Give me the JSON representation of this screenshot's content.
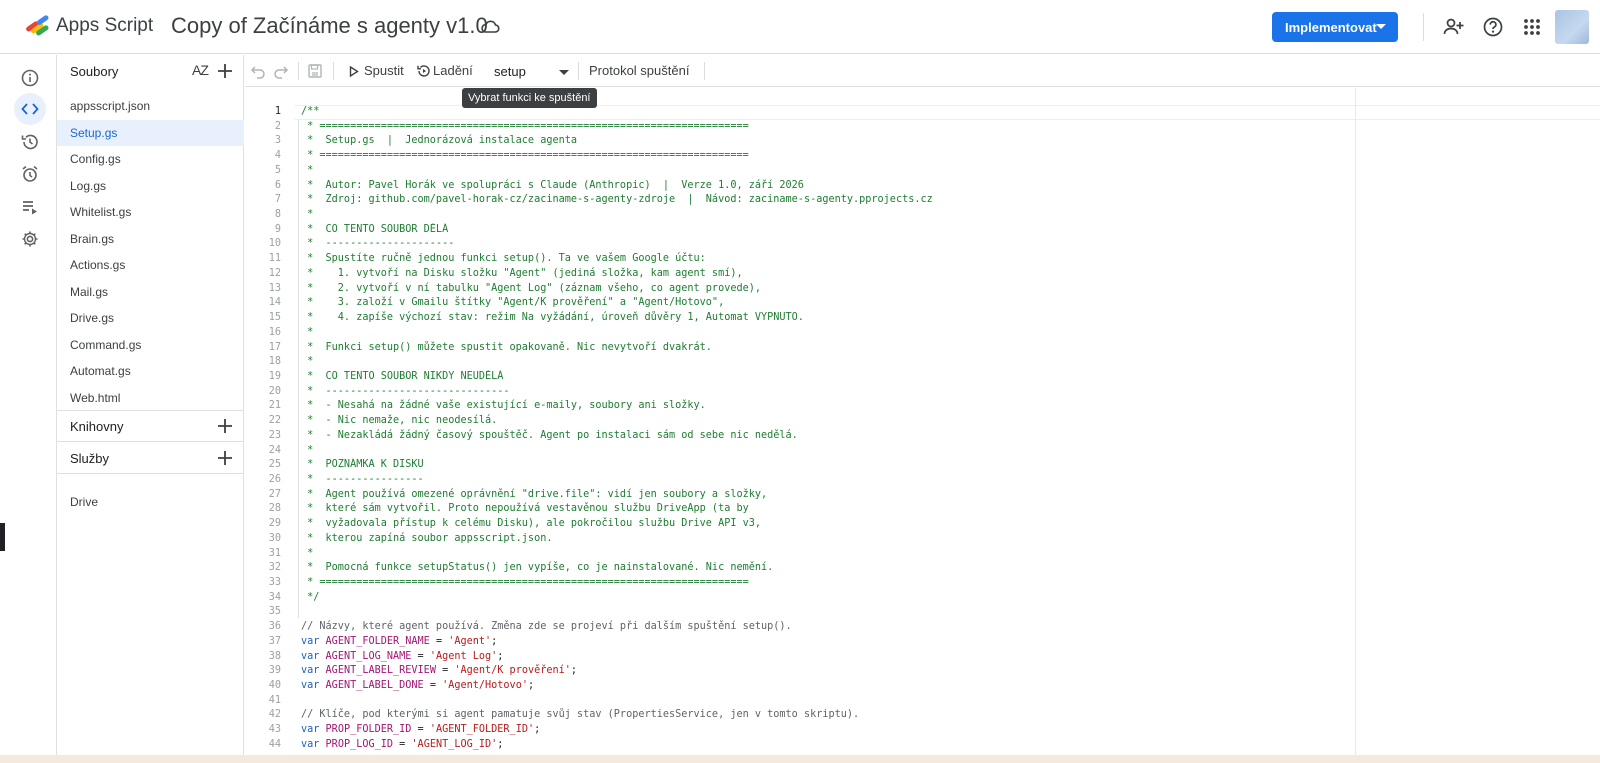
{
  "header": {
    "app_name": "Apps Script",
    "project_title": "Copy of Začínáme s agenty v1.0",
    "deploy_label": "Implementovat"
  },
  "rail": [
    "info-icon",
    "code-icon",
    "history-icon",
    "alarm-icon",
    "executions-icon",
    "settings-icon"
  ],
  "files": {
    "title": "Soubory",
    "sort_label": "AZ",
    "items": [
      "appsscript.json",
      "Setup.gs",
      "Config.gs",
      "Log.gs",
      "Whitelist.gs",
      "Brain.gs",
      "Actions.gs",
      "Mail.gs",
      "Drive.gs",
      "Command.gs",
      "Automat.gs",
      "Web.html"
    ],
    "active": "Setup.gs",
    "libraries_title": "Knihovny",
    "services_title": "Služby",
    "services": [
      "Drive"
    ]
  },
  "toolbar": {
    "run_label": "Spustit",
    "debug_label": "Ladění",
    "function_value": "setup",
    "log_label": "Protokol spuštění",
    "tooltip": "Vybrat funkci ke spuštění"
  },
  "code": {
    "current_line": 1,
    "line_numbers": [
      1,
      2,
      3,
      4,
      5,
      6,
      7,
      8,
      9,
      10,
      11,
      12,
      13,
      14,
      15,
      16,
      17,
      18,
      19,
      20,
      21,
      22,
      23,
      24,
      25,
      26,
      27,
      28,
      29,
      30,
      31,
      32,
      33,
      34,
      35,
      36,
      37,
      38,
      39,
      40,
      41,
      42,
      43,
      44
    ],
    "lines": [
      [
        [
          "cm",
          "/**"
        ]
      ],
      [
        [
          "cm",
          " * ======================================================================"
        ]
      ],
      [
        [
          "cm",
          " *  Setup.gs  |  Jednorázová instalace agenta"
        ]
      ],
      [
        [
          "cm",
          " * ======================================================================"
        ]
      ],
      [
        [
          "cm",
          " *"
        ]
      ],
      [
        [
          "cm",
          " *  Autor: Pavel Horák ve spolupráci s Claude (Anthropic)  |  Verze 1.0, září 2026"
        ]
      ],
      [
        [
          "cm",
          " *  Zdroj: github.com/pavel-horak-cz/zaciname-s-agenty-zdroje  |  Návod: zaciname-s-agenty.pprojects.cz"
        ]
      ],
      [
        [
          "cm",
          " *"
        ]
      ],
      [
        [
          "cm",
          " *  CO TENTO SOUBOR DĚLÁ"
        ]
      ],
      [
        [
          "cm",
          " *  ---------------------"
        ]
      ],
      [
        [
          "cm",
          " *  Spustíte ručně jednou funkci setup(). Ta ve vašem Google účtu:"
        ]
      ],
      [
        [
          "cm",
          " *    1. vytvoří na Disku složku \"Agent\" (jediná složka, kam agent smí),"
        ]
      ],
      [
        [
          "cm",
          " *    2. vytvoří v ní tabulku \"Agent Log\" (záznam všeho, co agent provede),"
        ]
      ],
      [
        [
          "cm",
          " *    3. založí v Gmailu štítky \"Agent/K prověření\" a \"Agent/Hotovo\","
        ]
      ],
      [
        [
          "cm",
          " *    4. zapíše výchozí stav: režim Na vyžádání, úroveň důvěry 1, Automat VYPNUTO."
        ]
      ],
      [
        [
          "cm",
          " *"
        ]
      ],
      [
        [
          "cm",
          " *  Funkci setup() můžete spustit opakovaně. Nic nevytvoří dvakrát."
        ]
      ],
      [
        [
          "cm",
          " *"
        ]
      ],
      [
        [
          "cm",
          " *  CO TENTO SOUBOR NIKDY NEUDĚLÁ"
        ]
      ],
      [
        [
          "cm",
          " *  ------------------------------"
        ]
      ],
      [
        [
          "cm",
          " *  - Nesahá na žádné vaše existující e-maily, soubory ani složky."
        ]
      ],
      [
        [
          "cm",
          " *  - Nic nemaže, nic neodesílá."
        ]
      ],
      [
        [
          "cm",
          " *  - Nezakládá žádný časový spouštěč. Agent po instalaci sám od sebe nic nedělá."
        ]
      ],
      [
        [
          "cm",
          " *"
        ]
      ],
      [
        [
          "cm",
          " *  POZNÁMKA K DISKU"
        ]
      ],
      [
        [
          "cm",
          " *  ----------------"
        ]
      ],
      [
        [
          "cm",
          " *  Agent používá omezené oprávnění \"drive.file\": vidí jen soubory a složky,"
        ]
      ],
      [
        [
          "cm",
          " *  které sám vytvořil. Proto nepoužívá vestavěnou službu DriveApp (ta by"
        ]
      ],
      [
        [
          "cm",
          " *  vyžadovala přístup k celému Disku), ale pokročilou službu Drive API v3,"
        ]
      ],
      [
        [
          "cm",
          " *  kterou zapíná soubor appsscript.json."
        ]
      ],
      [
        [
          "cm",
          " *"
        ]
      ],
      [
        [
          "cm",
          " *  Pomocná funkce setupStatus() jen vypíše, co je nainstalované. Nic nemění."
        ]
      ],
      [
        [
          "cm",
          " * ======================================================================"
        ]
      ],
      [
        [
          "cm",
          " */"
        ]
      ],
      [
        [
          "pl",
          ""
        ]
      ],
      [
        [
          "lc",
          "// Názvy, které agent používá. Změna zde se projeví při dalším spuštění setup()."
        ]
      ],
      [
        [
          "kw",
          "var "
        ],
        [
          "vn",
          "AGENT_FOLDER_NAME"
        ],
        [
          "pl",
          " = "
        ],
        [
          "st",
          "'Agent'"
        ],
        [
          "pl",
          ";"
        ]
      ],
      [
        [
          "kw",
          "var "
        ],
        [
          "vn",
          "AGENT_LOG_NAME"
        ],
        [
          "pl",
          " = "
        ],
        [
          "st",
          "'Agent Log'"
        ],
        [
          "pl",
          ";"
        ]
      ],
      [
        [
          "kw",
          "var "
        ],
        [
          "vn",
          "AGENT_LABEL_REVIEW"
        ],
        [
          "pl",
          " = "
        ],
        [
          "st",
          "'Agent/K prověření'"
        ],
        [
          "pl",
          ";"
        ]
      ],
      [
        [
          "kw",
          "var "
        ],
        [
          "vn",
          "AGENT_LABEL_DONE"
        ],
        [
          "pl",
          " = "
        ],
        [
          "st",
          "'Agent/Hotovo'"
        ],
        [
          "pl",
          ";"
        ]
      ],
      [
        [
          "pl",
          ""
        ]
      ],
      [
        [
          "lc",
          "// Klíče, pod kterými si agent pamatuje svůj stav (PropertiesService, jen v tomto skriptu)."
        ]
      ],
      [
        [
          "kw",
          "var "
        ],
        [
          "vn",
          "PROP_FOLDER_ID"
        ],
        [
          "pl",
          " = "
        ],
        [
          "st",
          "'AGENT_FOLDER_ID'"
        ],
        [
          "pl",
          ";"
        ]
      ],
      [
        [
          "kw",
          "var "
        ],
        [
          "vn",
          "PROP_LOG_ID"
        ],
        [
          "pl",
          " = "
        ],
        [
          "st",
          "'AGENT_LOG_ID'"
        ],
        [
          "pl",
          ";"
        ]
      ]
    ]
  }
}
